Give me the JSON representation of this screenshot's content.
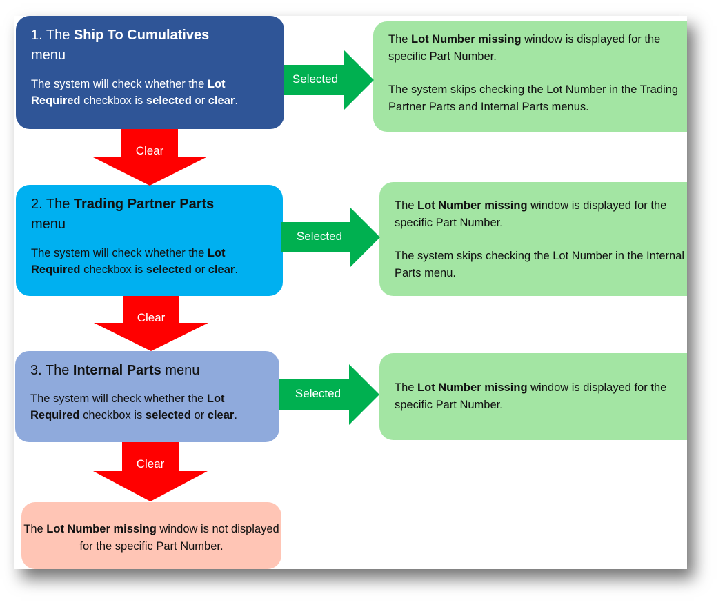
{
  "diagram": {
    "steps": [
      {
        "number": "1.",
        "title_pre": " The ",
        "title_bold": "Ship To Cumulatives",
        "title_post": " menu",
        "desc_pre": "The system will check whether the ",
        "desc_bold1": "Lot Required",
        "desc_mid": " checkbox is ",
        "desc_bold2": "selected",
        "desc_or": " or ",
        "desc_bold3": "clear",
        "desc_end": ".",
        "color": "#2f5597"
      },
      {
        "number": "2.",
        "title_pre": " The ",
        "title_bold": "Trading Partner Parts",
        "title_post": " menu",
        "desc_pre": "The system will check whether the ",
        "desc_bold1": "Lot Required",
        "desc_mid": " checkbox is ",
        "desc_bold2": "selected",
        "desc_or": " or ",
        "desc_bold3": "clear",
        "desc_end": ".",
        "color": "#00b0f0"
      },
      {
        "number": "3.",
        "title_pre": " The ",
        "title_bold": "Internal Parts",
        "title_post": " menu",
        "desc_pre": "The system will check whether the ",
        "desc_bold1": "Lot Required",
        "desc_mid": " checkbox is ",
        "desc_bold2": "selected",
        "desc_or": " or ",
        "desc_bold3": "clear",
        "desc_end": ".",
        "color": "#8faadc"
      }
    ],
    "results": [
      {
        "line1_pre": "The ",
        "line1_bold": "Lot Number missing",
        "line1_post": " window is displayed for the specific Part Number.",
        "line2": "The system skips checking the Lot Number in the Trading Partner Parts and Internal Parts menus."
      },
      {
        "line1_pre": "The ",
        "line1_bold": "Lot Number missing",
        "line1_post": " window is displayed for the specific Part Number.",
        "line2": "The system skips checking the Lot Number in the Internal Parts menu."
      },
      {
        "line1_pre": "The ",
        "line1_bold": "Lot Number missing",
        "line1_post": " window is displayed for the specific Part Number."
      }
    ],
    "final": {
      "pre": "The ",
      "bold": "Lot Number missing",
      "post": " window is not displayed for the specific Part Number."
    },
    "arrows": {
      "selected_label": "Selected",
      "clear_label": "Clear"
    },
    "colors": {
      "selected_arrow": "#00b050",
      "clear_arrow": "#ff0000",
      "result_box": "#a3e5a3",
      "final_box": "#ffc5b5"
    }
  }
}
